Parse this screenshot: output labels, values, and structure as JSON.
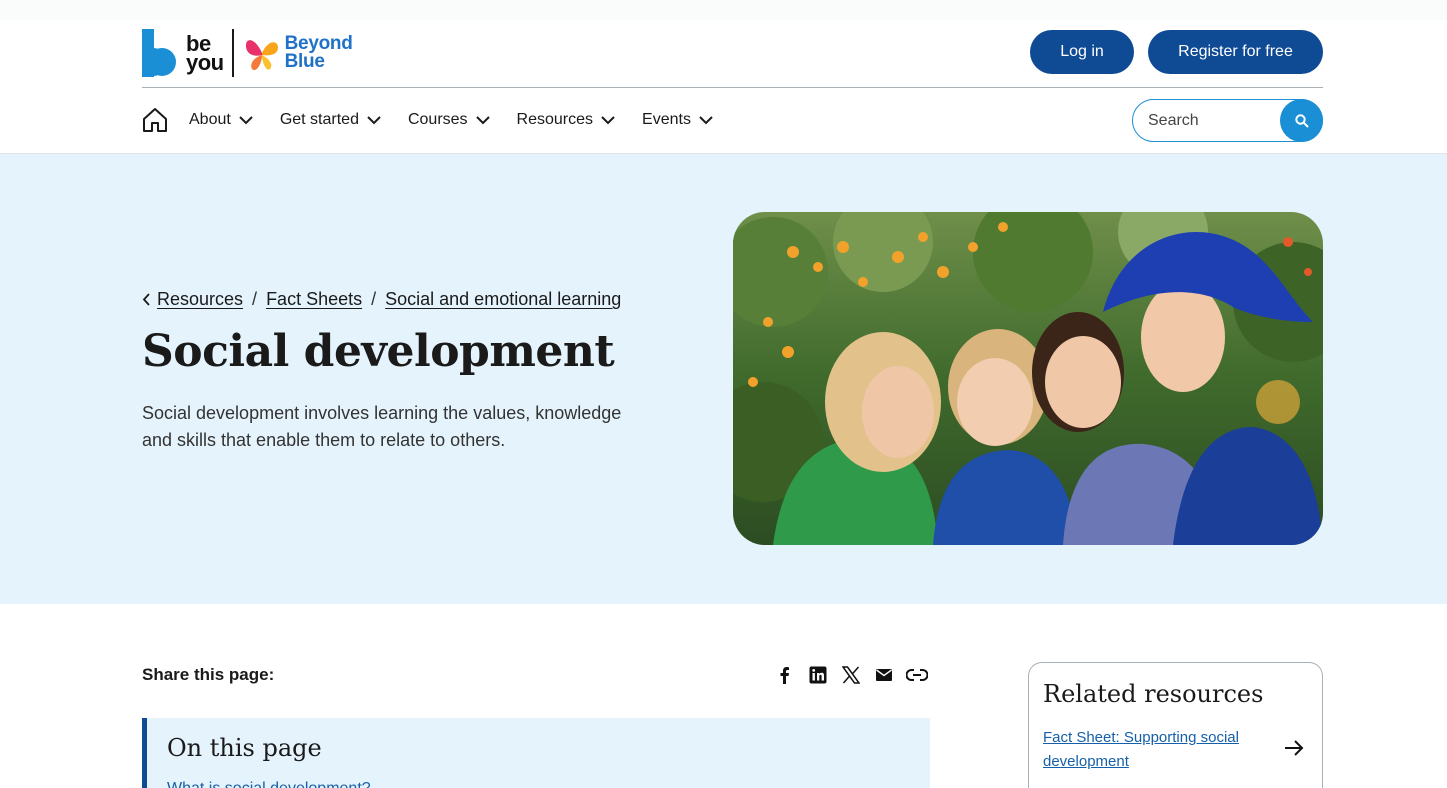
{
  "brand": {
    "beyou_line1": "be",
    "beyou_line2": "you",
    "partner_line1": "Beyond",
    "partner_line2": "Blue",
    "colors": {
      "primary": "#0f4a94",
      "accent": "#1a8fd6",
      "hero_bg": "#e5f3fc",
      "link": "#1560a8"
    }
  },
  "header": {
    "login_label": "Log in",
    "register_label": "Register for free"
  },
  "nav": {
    "home_icon": "home-icon",
    "items": [
      {
        "label": "About"
      },
      {
        "label": "Get started"
      },
      {
        "label": "Courses"
      },
      {
        "label": "Resources"
      },
      {
        "label": "Events"
      }
    ]
  },
  "search": {
    "placeholder": "Search",
    "button_icon": "search-icon"
  },
  "breadcrumb": [
    {
      "label": "Resources"
    },
    {
      "label": "Fact Sheets"
    },
    {
      "label": "Social and emotional learning"
    }
  ],
  "hero": {
    "title": "Social development",
    "lede": "Social development involves learning the values, knowledge and skills that enable them to relate to others.",
    "image_alt": "Four smiling school children hugging outdoors"
  },
  "share": {
    "label": "Share this page:",
    "icons": [
      "facebook-icon",
      "linkedin-icon",
      "x-icon",
      "email-icon",
      "link-icon"
    ]
  },
  "on_this_page": {
    "title": "On this page",
    "first_link": "What is social development?"
  },
  "related": {
    "title": "Related resources",
    "items": [
      {
        "label": "Fact Sheet: Supporting social development"
      }
    ]
  }
}
